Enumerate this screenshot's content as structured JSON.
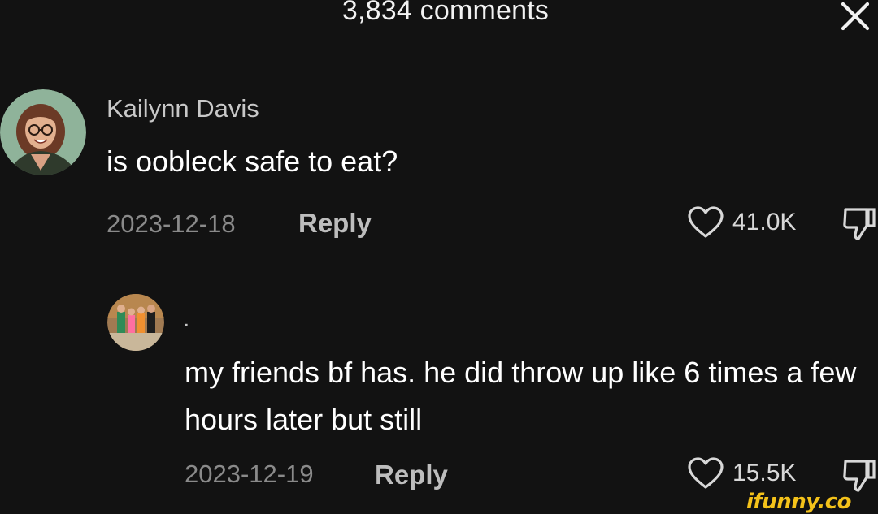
{
  "header": {
    "title": "3,834 comments"
  },
  "comments": [
    {
      "username": "Kailynn Davis",
      "text": "is oobleck safe to eat?",
      "date": "2023-12-18",
      "reply_label": "Reply",
      "likes": "41.0K"
    },
    {
      "username": ".",
      "text": "my friends bf has. he did throw up like 6 times a few hours later but still",
      "date": "2023-12-19",
      "reply_label": "Reply",
      "likes": "15.5K"
    }
  ],
  "watermark": "ifunny.co",
  "icons": {
    "close": "close-icon",
    "like": "heart-outline-icon",
    "dislike": "thumbs-down-icon"
  },
  "colors": {
    "background": "#121212",
    "text_primary": "#ffffff",
    "text_secondary": "#8a8a8a",
    "watermark": "#f4c21a"
  }
}
